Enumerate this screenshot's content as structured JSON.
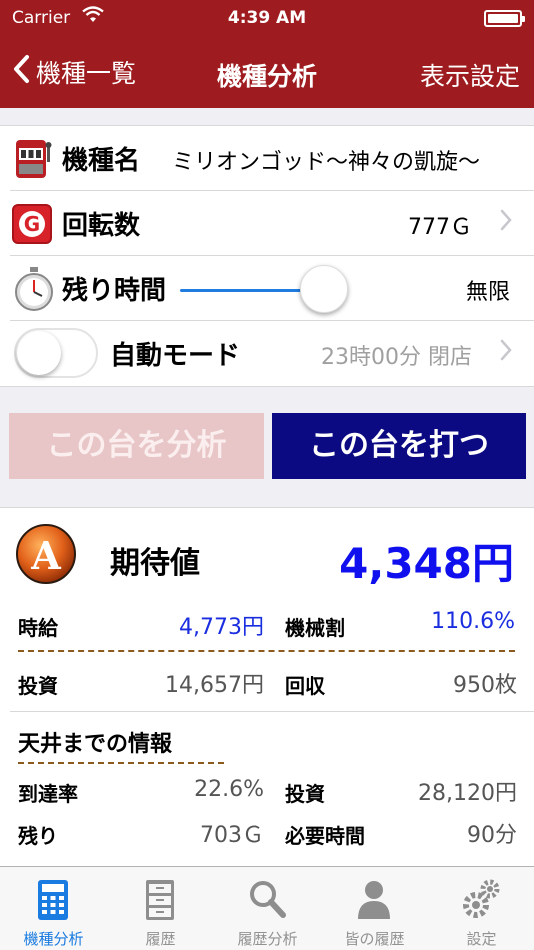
{
  "status_bar": {
    "carrier": "Carrier",
    "time": "4:39 AM"
  },
  "nav": {
    "back_label": "機種一覧",
    "title": "機種分析",
    "right_label": "表示設定"
  },
  "settings": {
    "machine": {
      "label": "機種名",
      "value": "ミリオンゴッド〜神々の凱旋〜"
    },
    "spins": {
      "label": "回転数",
      "value": "777Ｇ"
    },
    "remaining": {
      "label": "残り時間",
      "value": "無限",
      "slider_level": 0.8
    },
    "auto_mode": {
      "label": "自動モード",
      "value": "23時00分 閉店",
      "enabled": false
    }
  },
  "buttons": {
    "analyze": "この台を分析",
    "play": "この台を打つ"
  },
  "result": {
    "badge": "A",
    "expected_label": "期待値",
    "expected_value": "4,348円",
    "hourly_label": "時給",
    "hourly_value": "4,773円",
    "machine_rate_label": "機械割",
    "machine_rate_value": "110.6%",
    "invest_label": "投資",
    "invest_value": "14,657円",
    "return_label": "回収",
    "return_value": "950枚",
    "ceiling_heading": "天井までの情報",
    "reach_rate_label": "到達率",
    "reach_rate_value": "22.6%",
    "ceiling_invest_label": "投資",
    "ceiling_invest_value": "28,120円",
    "remaining_label": "残り",
    "remaining_value": "703Ｇ",
    "required_time_label": "必要時間",
    "required_time_value": "90分"
  },
  "tabs": [
    {
      "label": "機種分析",
      "icon": "calculator-icon",
      "active": true
    },
    {
      "label": "履歴",
      "icon": "cabinet-icon",
      "active": false
    },
    {
      "label": "履歴分析",
      "icon": "magnifier-icon",
      "active": false
    },
    {
      "label": "皆の履歴",
      "icon": "person-icon",
      "active": false
    },
    {
      "label": "設定",
      "icon": "gears-icon",
      "active": false
    }
  ],
  "colors": {
    "nav_bg": "#9e1c1f",
    "accent_blue": "#1a2ee0",
    "play_button": "#0b0a82",
    "tab_active": "#1a7be0"
  }
}
